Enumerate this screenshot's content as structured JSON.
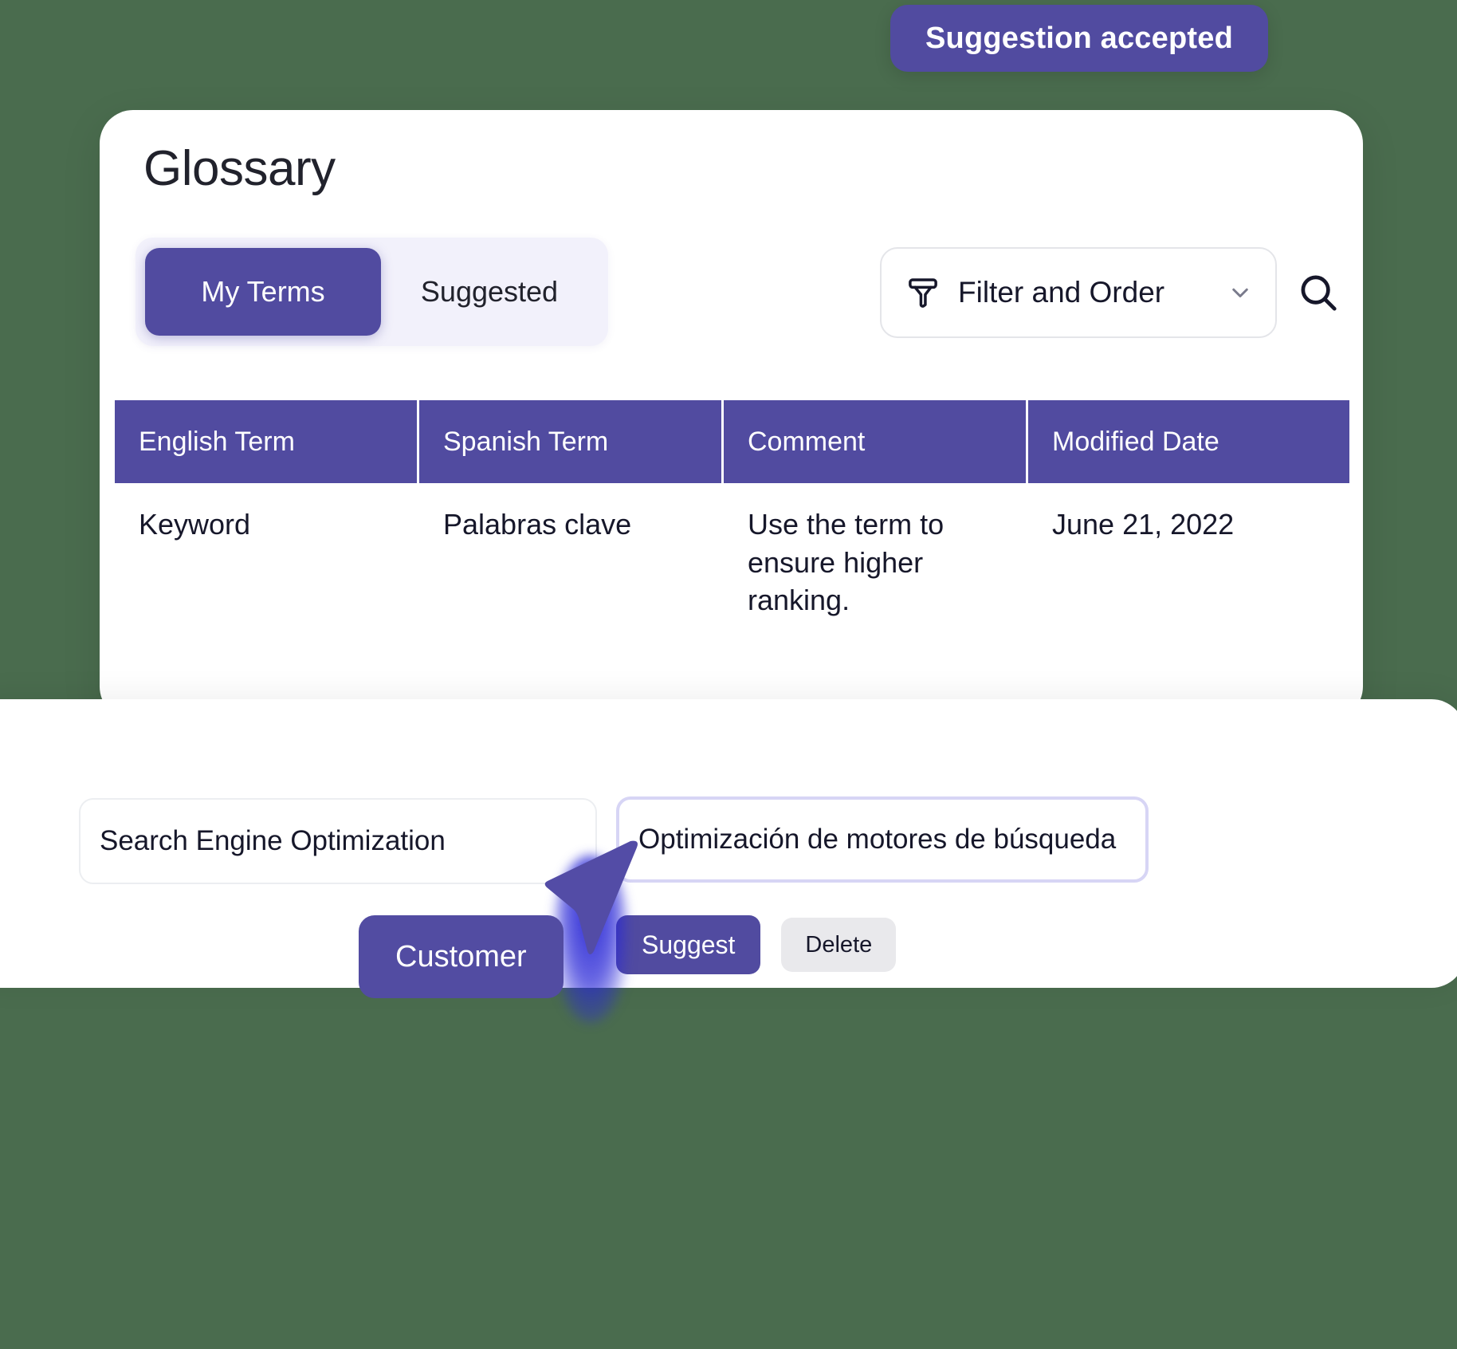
{
  "colors": {
    "background": "#4a6c4e",
    "brand_purple": "#514ba0",
    "tab_track": "#f2f1fb",
    "focus_border": "#d7d5f5",
    "cursor_blue": "#2220d2",
    "delete_button_bg": "#e9e9ec"
  },
  "toast": {
    "label": "Suggestion accepted"
  },
  "glossary": {
    "title": "Glossary",
    "tabs": [
      {
        "label": "My Terms",
        "active": true
      },
      {
        "label": "Suggested",
        "active": false
      }
    ],
    "filter": {
      "icon": "filter-funnel-icon",
      "label": "Filter and Order",
      "chevron": "chevron-down-icon"
    },
    "search": {
      "icon": "search-icon"
    },
    "table": {
      "columns": [
        "English Term",
        "Spanish Term",
        "Comment",
        "Modified Date"
      ],
      "rows": [
        {
          "english_term": "Keyword",
          "spanish_term": "Palabras clave",
          "comment": "Use the term to ensure higher ranking.",
          "modified_date": "June 21, 2022"
        }
      ]
    }
  },
  "editor": {
    "english_field": {
      "value": "Search Engine Optimization",
      "placeholder": "English term"
    },
    "spanish_field": {
      "value": "Optimización de motores de búsqueda",
      "placeholder": "Spanish term"
    },
    "buttons": {
      "suggest": "Suggest",
      "delete": "Delete"
    }
  },
  "cursor": {
    "persona_label": "Customer",
    "icon": "mouse-pointer-icon"
  }
}
